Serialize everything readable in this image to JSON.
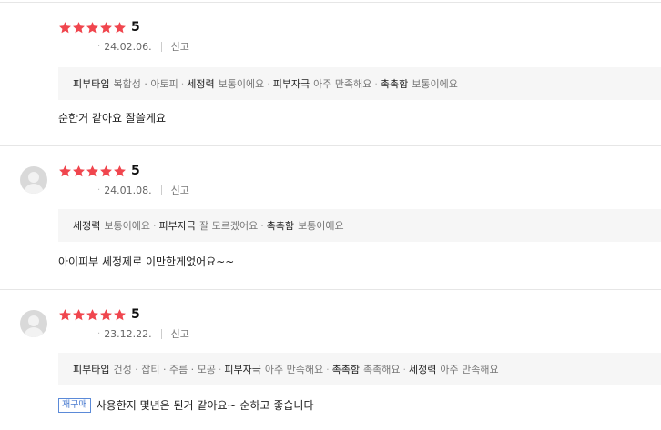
{
  "reviews": [
    {
      "has_avatar": false,
      "rating": 5,
      "score_label": "5",
      "date": "24.02.06.",
      "report_label": "신고",
      "attributes": [
        {
          "key": "피부타입",
          "value": "복합성 · 아토피"
        },
        {
          "key": "세정력",
          "value": "보통이에요"
        },
        {
          "key": "피부자극",
          "value": "아주 만족해요"
        },
        {
          "key": "촉촉함",
          "value": "보통이에요"
        }
      ],
      "repurchase_badge": "",
      "text": "순한거 같아요 잘쓸게요"
    },
    {
      "has_avatar": true,
      "rating": 5,
      "score_label": "5",
      "date": "24.01.08.",
      "report_label": "신고",
      "attributes": [
        {
          "key": "세정력",
          "value": "보통이에요"
        },
        {
          "key": "피부자극",
          "value": "잘 모르겠어요"
        },
        {
          "key": "촉촉함",
          "value": "보통이에요"
        }
      ],
      "repurchase_badge": "",
      "text": "아이피부 세정제로 이만한게없어요~~"
    },
    {
      "has_avatar": true,
      "rating": 5,
      "score_label": "5",
      "date": "23.12.22.",
      "report_label": "신고",
      "attributes": [
        {
          "key": "피부타입",
          "value": "건성 · 잡티 · 주름 · 모공"
        },
        {
          "key": "피부자극",
          "value": "아주 만족해요"
        },
        {
          "key": "촉촉함",
          "value": "촉촉해요"
        },
        {
          "key": "세정력",
          "value": "아주 만족해요"
        }
      ],
      "repurchase_badge": "재구매",
      "text": "사용한지 몇년은 된거 같아요~ 순하고 좋습니다"
    }
  ],
  "colors": {
    "star": "#f0464e",
    "badge": "#4a7bd0",
    "attrs_bg": "#f6f6f6"
  },
  "icons": {
    "star": "star-icon",
    "avatar": "user-avatar-icon",
    "dot": "dot-separator"
  }
}
